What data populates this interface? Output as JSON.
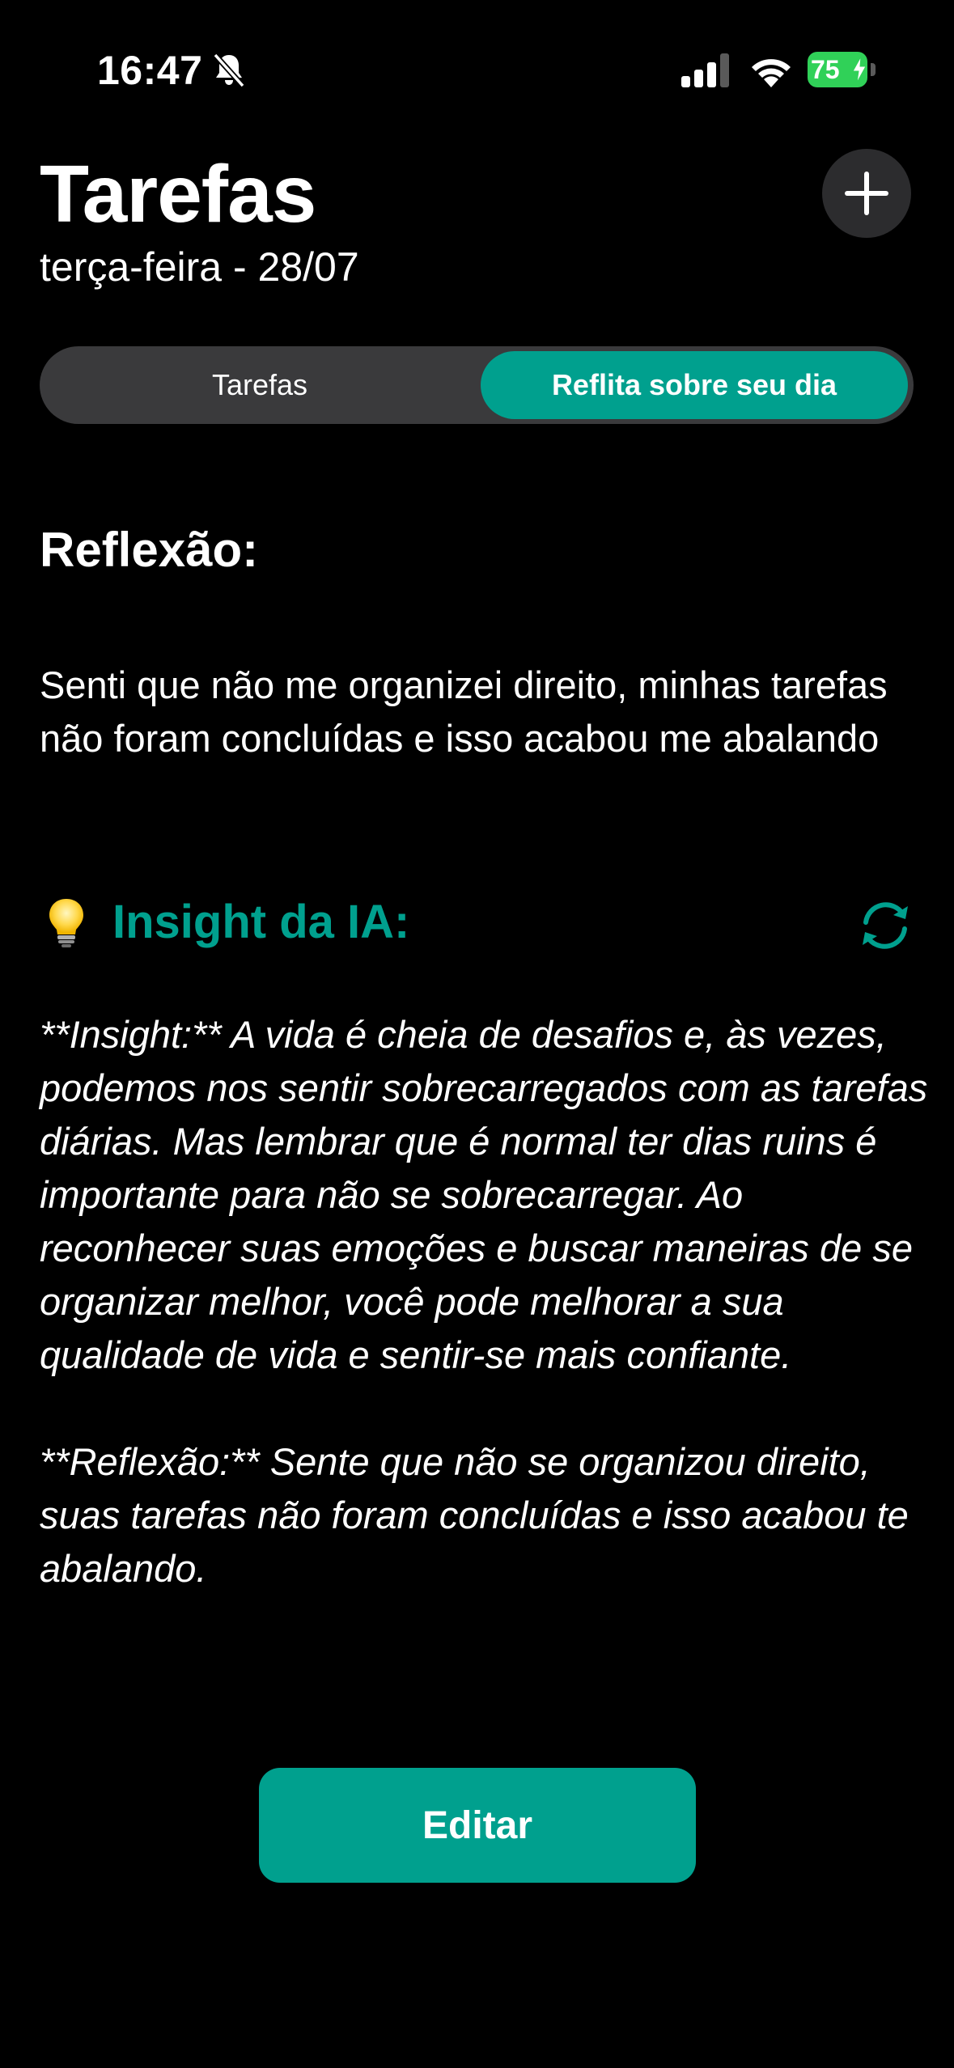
{
  "status_bar": {
    "time": "16:47",
    "battery_level": "75",
    "icons": [
      "bell-slash-icon",
      "cellular-signal-icon",
      "wifi-icon",
      "battery-charging-icon"
    ]
  },
  "header": {
    "title": "Tarefas",
    "date": "terça-feira - 28/07",
    "add_icon": "plus-icon"
  },
  "segmented": {
    "tabs": [
      {
        "label": "Tarefas",
        "selected": false
      },
      {
        "label": "Reflita sobre seu dia",
        "selected": true
      }
    ]
  },
  "reflection": {
    "title": "Reflexão:",
    "text": "Senti que não me organizei direito, minhas tarefas não foram concluídas e isso acabou me abalando"
  },
  "insight": {
    "icon": "lightbulb-icon",
    "title": "Insight da IA:",
    "refresh_icon": "refresh-icon",
    "paragraphs": [
      "**Insight:** A vida é cheia de desafios e, às vezes, podemos nos sentir sobrecarregados com as tarefas diárias. Mas lembrar que é normal ter dias ruins é importante para não se sobrecarregar. Ao reconhecer suas emoções e buscar maneiras de se organizar melhor, você pode melhorar a sua qualidade de vida e sentir-se mais confiante.",
      "**Reflexão:** Sente que não se organizou direito, suas tarefas não foram concluídas e isso acabou te abalando."
    ]
  },
  "actions": {
    "edit_label": "Editar"
  },
  "colors": {
    "accent": "#00a08e",
    "background": "#000000",
    "segment_bg": "#3a3a3c",
    "button_dark": "#2c2c2e",
    "battery": "#30d158"
  }
}
